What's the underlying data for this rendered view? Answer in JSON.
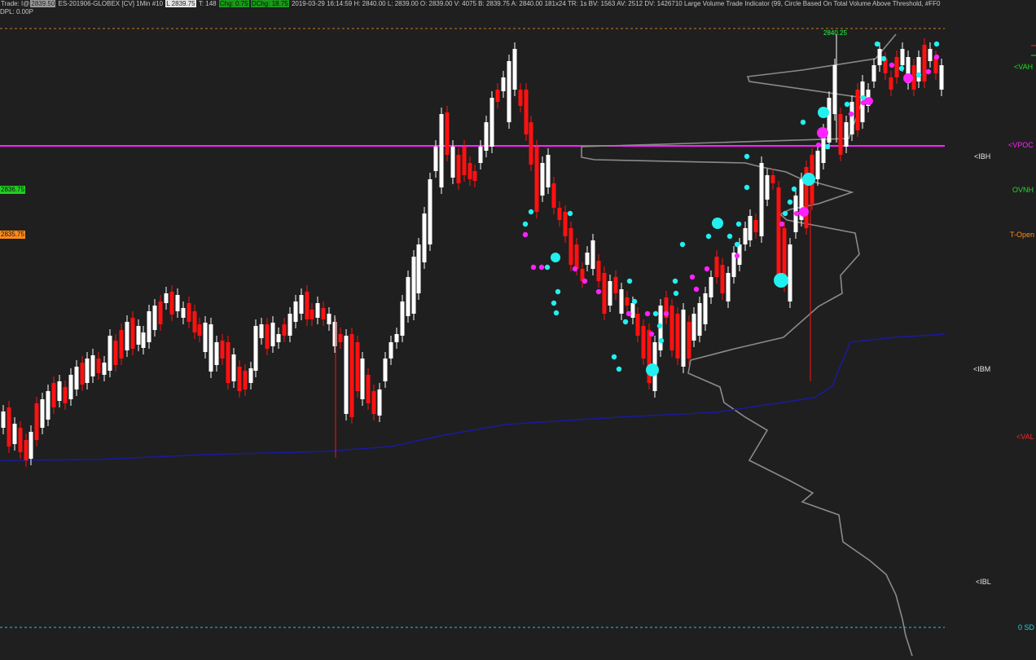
{
  "header": {
    "trade_prefix": "Trade: I@",
    "trade_price": "2839.50",
    "symbol": "ES-201906-GLOBEX [CV] 1Min  #10",
    "last_box": "L 2839.75",
    "ticks": "T: 148",
    "chg_box": "Chg: 0.75",
    "dchg_box": "DChg: 18.75",
    "details": "2019-03-29 16:14:59 H: 2840.00 L: 2839.00 O: 2839.00 V: 4075 B: 2839.75 A: 2840.00 181x24 TR: 1s BV: 1563 AV: 2512 DV: 1426710 Large Volume Trade Indicator  (99, Circle Based On Total Volume Above Threshold, #FF0",
    "sub": "DPL: 0.00P"
  },
  "peak_label": "2840.25",
  "right_labels": [
    {
      "text": "<VAH",
      "color": "#22dd22"
    },
    {
      "text": "<VPOC",
      "color": "#ff22ff"
    },
    {
      "text": "<IBH",
      "color": "#e6e6e6"
    },
    {
      "text": "OVNH",
      "color": "#22dd22"
    },
    {
      "text": "T-Open",
      "color": "#ff8c1a"
    },
    {
      "text": "<IBM",
      "color": "#e6e6e6"
    },
    {
      "text": "<VAL",
      "color": "#ff2222"
    },
    {
      "text": "<IBL",
      "color": "#e6e6e6"
    },
    {
      "text": "0 SD",
      "color": "#22d6dc"
    }
  ],
  "left_tags": [
    {
      "text": "2836.75",
      "color": "#22cc22"
    },
    {
      "text": "2835.75",
      "color": "#ff8c1a"
    }
  ],
  "colors": {
    "background": "#1f1f1f",
    "up_candle": "#ffffff",
    "down_candle": "#ff1111",
    "vpoc_line": "#ff22ff",
    "vwap_line": "#1a1aa0",
    "profile_line": "#8a8a8a",
    "ovnh_dash": "#c8781e",
    "sd_dash": "#22c8c8",
    "cyan_dots": "#22f0f0",
    "magenta_dots": "#ff22ff"
  }
}
